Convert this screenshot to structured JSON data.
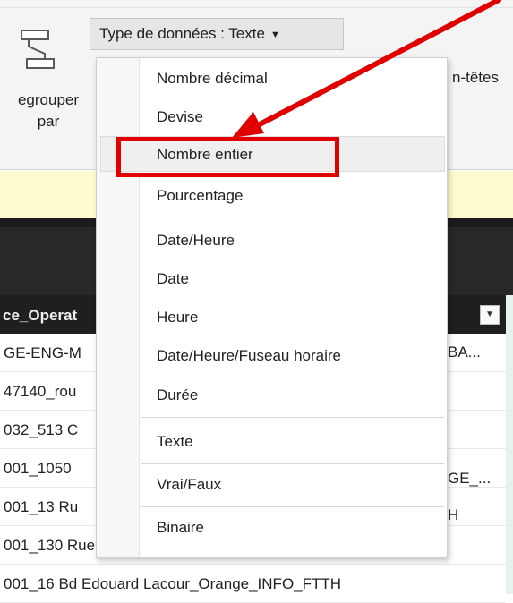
{
  "ribbon": {
    "group_by_label_line1": "egrouper",
    "group_by_label_line2": "par",
    "data_type_button": "Type de données : Texte",
    "headers_label": "n-têtes"
  },
  "table": {
    "column_header": "ce_Operat",
    "rows": [
      {
        "left": "GE-ENG-M",
        "right": "BA..."
      },
      {
        "left": "47140_rou",
        "right": ""
      },
      {
        "left": "032_513 C",
        "right": ""
      },
      {
        "left": "001_1050",
        "right": "GE_..."
      },
      {
        "left": "001_13 Ru",
        "right": "H"
      },
      {
        "left": "001_130 Rue Jules Raimu_ORANGE_ENGIE_FTTH",
        "right": ""
      },
      {
        "left": "001_16 Bd Edouard Lacour_Orange_INFO_FTTH",
        "right": ""
      }
    ]
  },
  "menu": {
    "items": [
      "Nombre décimal",
      "Devise",
      "Nombre entier",
      "Pourcentage",
      "Date/Heure",
      "Date",
      "Heure",
      "Date/Heure/Fuseau horaire",
      "Durée",
      "Texte",
      "Vrai/Faux",
      "Binaire"
    ],
    "highlighted_item": "Nombre entier"
  },
  "colors": {
    "annotation_red": "#e00000",
    "info_bar_yellow": "#fffbd0",
    "header_dark": "#1f1f1f",
    "ribbon_bg": "#f4f4f4"
  },
  "icons": {
    "group_by": "group-by-icon",
    "dropdown_caret": "caret-down-icon",
    "column_filter": "filter-dropdown-icon"
  }
}
